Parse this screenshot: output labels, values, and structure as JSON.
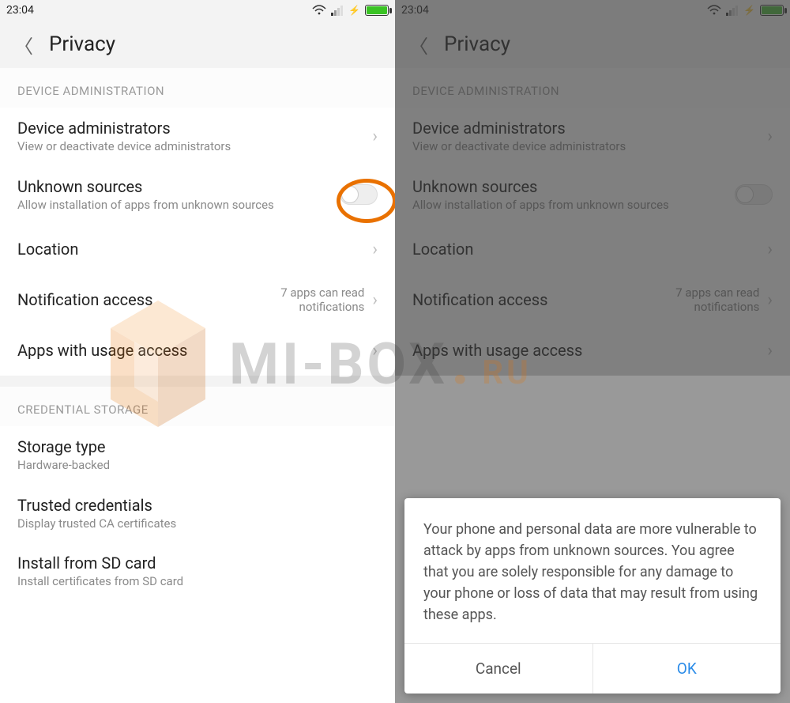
{
  "status": {
    "time": "23:04"
  },
  "header": {
    "title": "Privacy"
  },
  "sections": {
    "device_admin": {
      "header": "DEVICE ADMINISTRATION",
      "device_admins": {
        "title": "Device administrators",
        "sub": "View or deactivate device administrators"
      },
      "unknown_sources": {
        "title": "Unknown sources",
        "sub": "Allow installation of apps from unknown sources"
      },
      "location": {
        "title": "Location"
      },
      "notification_access": {
        "title": "Notification access",
        "value": "7 apps can read notifications"
      },
      "apps_usage": {
        "title": "Apps with usage access"
      }
    },
    "credential_storage": {
      "header": "CREDENTIAL STORAGE",
      "storage_type": {
        "title": "Storage type",
        "sub": "Hardware-backed"
      },
      "trusted": {
        "title": "Trusted credentials",
        "sub": "Display trusted CA certificates"
      },
      "install_sd": {
        "title": "Install from SD card",
        "sub": "Install certificates from SD card"
      }
    }
  },
  "dialog": {
    "body": "Your phone and personal data are more vulnerable to attack by apps from unknown sources. You agree that you are solely responsible for any damage to your phone or loss of data that may result from using these apps.",
    "cancel": "Cancel",
    "ok": "OK"
  },
  "watermark": {
    "text1": "MI-BOX",
    "text2": "RU"
  }
}
